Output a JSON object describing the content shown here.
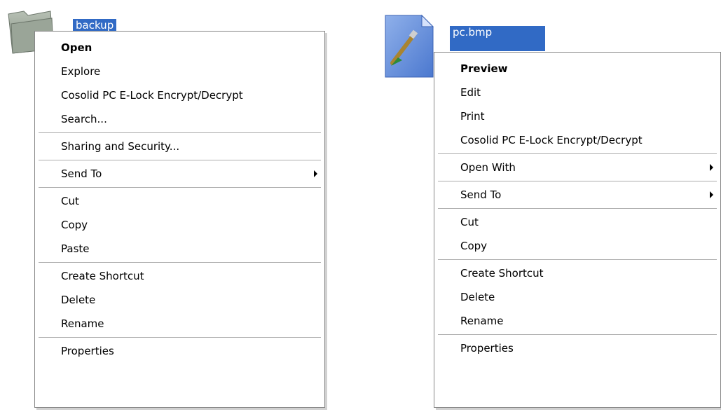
{
  "folder_file": {
    "name": "backup",
    "icon": "folder-icon"
  },
  "image_file": {
    "name": "pc.bmp",
    "icon": "bitmap-file-icon"
  },
  "folder_menu": {
    "open": "Open",
    "explore": "Explore",
    "encrypt": "Cosolid PC E-Lock Encrypt/Decrypt",
    "search": "Search...",
    "sharing": "Sharing and Security...",
    "send_to": "Send To",
    "cut": "Cut",
    "copy": "Copy",
    "paste": "Paste",
    "create_shortcut": "Create Shortcut",
    "delete": "Delete",
    "rename": "Rename",
    "properties": "Properties"
  },
  "file_menu": {
    "preview": "Preview",
    "edit": "Edit",
    "print": "Print",
    "encrypt": "Cosolid PC E-Lock Encrypt/Decrypt",
    "open_with": "Open With",
    "send_to": "Send To",
    "cut": "Cut",
    "copy": "Copy",
    "create_shortcut": "Create Shortcut",
    "delete": "Delete",
    "rename": "Rename",
    "properties": "Properties"
  },
  "colors": {
    "selection": "#316ac5",
    "menu_border": "#868686",
    "separator": "#acacac"
  }
}
